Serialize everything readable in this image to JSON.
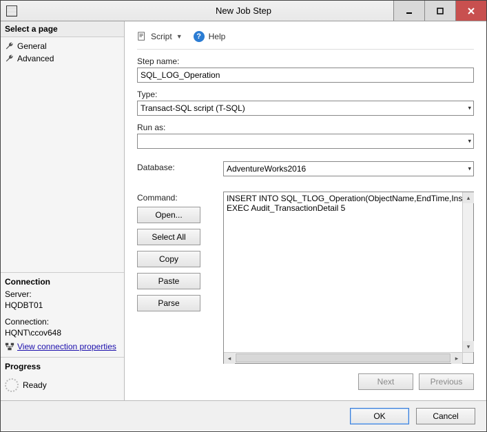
{
  "window": {
    "title": "New Job Step"
  },
  "sidebar": {
    "select_page": "Select a page",
    "pages": [
      "General",
      "Advanced"
    ],
    "connection": {
      "heading": "Connection",
      "server_label": "Server:",
      "server_value": "HQDBT01",
      "conn_label": "Connection:",
      "conn_value": "HQNT\\ccov648",
      "view_props": "View connection properties"
    },
    "progress": {
      "heading": "Progress",
      "status": "Ready"
    }
  },
  "toolbar": {
    "script_label": "Script",
    "help_label": "Help"
  },
  "form": {
    "step_label": "Step name:",
    "step_value": "SQL_LOG_Operation",
    "type_label": "Type:",
    "type_value": "Transact-SQL script (T-SQL)",
    "runas_label": "Run as:",
    "runas_value": "",
    "database_label": "Database:",
    "database_value": "AdventureWorks2016",
    "command_label": "Command:",
    "command_value": "INSERT INTO SQL_TLOG_Operation(ObjectName,EndTime,InsertCnt,U\nEXEC Audit_TransactionDetail 5",
    "buttons": {
      "open": "Open...",
      "select_all": "Select All",
      "copy": "Copy",
      "paste": "Paste",
      "parse": "Parse"
    },
    "nav": {
      "next": "Next",
      "prev": "Previous"
    }
  },
  "footer": {
    "ok": "OK",
    "cancel": "Cancel"
  }
}
